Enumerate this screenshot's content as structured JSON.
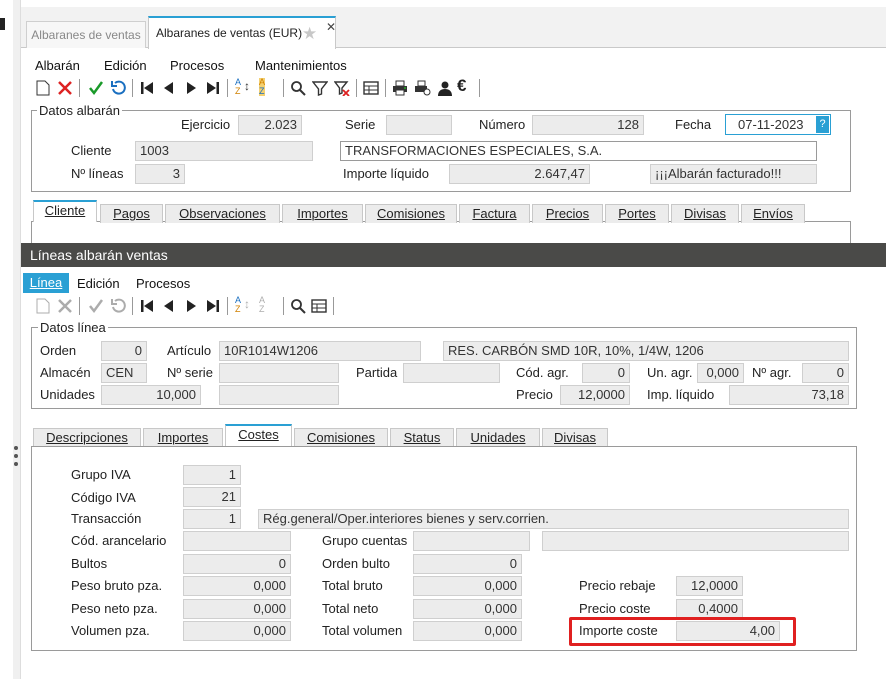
{
  "window": {
    "tabs": [
      {
        "label": "Albaranes de ventas"
      },
      {
        "label": "Albaranes de ventas (EUR)"
      }
    ]
  },
  "menu": {
    "items": [
      "Albarán",
      "Edición",
      "Procesos",
      "Mantenimientos"
    ]
  },
  "header": {
    "section_title": "Datos albarán",
    "ejercicio_label": "Ejercicio",
    "ejercicio_value": "2.023",
    "serie_label": "Serie",
    "serie_value": "",
    "numero_label": "Número",
    "numero_value": "128",
    "fecha_label": "Fecha",
    "fecha_value": "07-11-2023",
    "cliente_label": "Cliente",
    "cliente_code": "1003",
    "cliente_name": "TRANSFORMACIONES ESPECIALES, S.A.",
    "nlineas_label": "Nº líneas",
    "nlineas_value": "3",
    "importe_label": "Importe líquido",
    "importe_value": "2.647,47",
    "status_text": "¡¡¡Albarán facturado!!!"
  },
  "doc_tabs": [
    "Cliente",
    "Pagos",
    "Observaciones",
    "Importes",
    "Comisiones",
    "Factura",
    "Precios",
    "Portes",
    "Divisas",
    "Envíos"
  ],
  "lines": {
    "bar_title": "Líneas albarán ventas",
    "menu": [
      "Línea",
      "Edición",
      "Procesos"
    ],
    "section_title": "Datos línea",
    "orden_label": "Orden",
    "orden_value": "0",
    "articulo_label": "Artículo",
    "articulo_code": "10R1014W1206",
    "articulo_desc": "RES. CARBÓN SMD 10R, 10%, 1/4W, 1206",
    "almacen_label": "Almacén",
    "almacen_value": "CEN",
    "nserie_label": "Nº serie",
    "nserie_value": "",
    "partida_label": "Partida",
    "partida_value": "",
    "codagr_label": "Cód. agr.",
    "codagr_value": "0",
    "unagr_label": "Un. agr.",
    "unagr_value": "0,000",
    "nagr_label": "Nº agr.",
    "nagr_value": "0",
    "unidades_label": "Unidades",
    "unidades_value": "10,000",
    "precio_label": "Precio",
    "precio_value": "12,0000",
    "impliq_label": "Imp. líquido",
    "impliq_value": "73,18"
  },
  "line_tabs": [
    "Descripciones",
    "Importes",
    "Costes",
    "Comisiones",
    "Status",
    "Unidades",
    "Divisas"
  ],
  "costes": {
    "grupo_iva_label": "Grupo IVA",
    "grupo_iva_value": "1",
    "codigo_iva_label": "Código IVA",
    "codigo_iva_value": "21",
    "transaccion_label": "Transacción",
    "transaccion_code": "1",
    "transaccion_desc": "Rég.general/Oper.interiores bienes y serv.corrien.",
    "cod_arancelario_label": "Cód. arancelario",
    "cod_arancelario_value": "",
    "grupo_cuentas_label": "Grupo cuentas",
    "grupo_cuentas_value": "",
    "grupo_cuentas_desc": "",
    "bultos_label": "Bultos",
    "bultos_value": "0",
    "orden_bulto_label": "Orden bulto",
    "orden_bulto_value": "0",
    "peso_bruto_label": "Peso bruto pza.",
    "peso_bruto_value": "0,000",
    "total_bruto_label": "Total bruto",
    "total_bruto_value": "0,000",
    "precio_rebaje_label": "Precio rebaje",
    "precio_rebaje_value": "12,0000",
    "peso_neto_label": "Peso neto pza.",
    "peso_neto_value": "0,000",
    "total_neto_label": "Total neto",
    "total_neto_value": "0,000",
    "precio_coste_label": "Precio coste",
    "precio_coste_value": "0,4000",
    "volumen_label": "Volumen pza.",
    "volumen_value": "0,000",
    "total_volumen_label": "Total volumen",
    "total_volumen_value": "0,000",
    "importe_coste_label": "Importe coste",
    "importe_coste_value": "4,00"
  },
  "colors": {
    "accent": "#2aa0d4",
    "dark_bar": "#4a4a48",
    "highlight": "#e02020"
  }
}
